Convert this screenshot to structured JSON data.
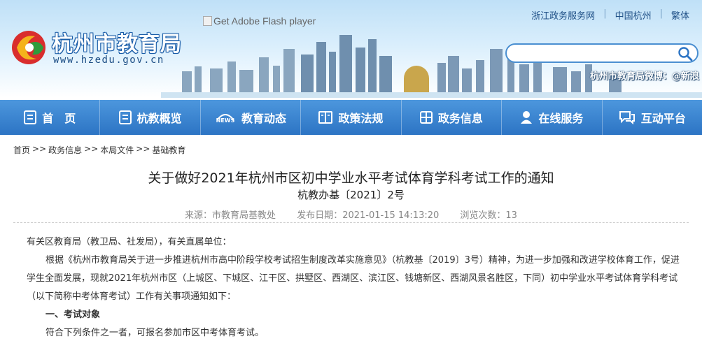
{
  "header": {
    "site_name": "杭州市教育局",
    "site_url": "www.hzedu.gov.cn",
    "flash_placeholder": "Get Adobe Flash player",
    "top_links": [
      "浙江政务服务网",
      "中国杭州",
      "繁体"
    ],
    "search_placeholder": "",
    "weibo_text": "杭州市教育局微博：@新浪"
  },
  "nav": {
    "items": [
      {
        "label": "首　页",
        "icon": "doc-icon"
      },
      {
        "label": "杭教概览",
        "icon": "doc-icon"
      },
      {
        "label": "教育动态",
        "icon": "news-icon"
      },
      {
        "label": "政策法规",
        "icon": "book-icon"
      },
      {
        "label": "政务信息",
        "icon": "grid-icon"
      },
      {
        "label": "在线服务",
        "icon": "person-icon"
      },
      {
        "label": "互动平台",
        "icon": "chat-icon"
      }
    ]
  },
  "breadcrumb": {
    "items": [
      "首页",
      "政务信息",
      "本局文件",
      "基础教育"
    ],
    "separator": ">>"
  },
  "article": {
    "title": "关于做好2021年杭州市区初中学业水平考试体育学科考试工作的通知",
    "doc_number": "杭教办基〔2021〕2号",
    "source": "来源：市教育局基教处",
    "publish_date": "发布日期：2021-01-15 14:13:20",
    "views": "浏览次数：13",
    "paragraphs": [
      "有关区教育局（教卫局、社发局），有关直属单位：",
      "根据《杭州市教育局关于进一步推进杭州市高中阶段学校考试招生制度改革实施意见》（杭教基〔2019〕3号）精神，为进一步加强和改进学校体育工作，促进学生全面发展，现就2021年杭州市区（上城区、下城区、江干区、拱墅区、西湖区、滨江区、钱塘新区、西湖风景名胜区，下同）初中学业水平考试体育学科考试（以下简称中考体育考试）工作有关事项通知如下：",
      "一、考试对象",
      "符合下列条件之一者，可报名参加市区中考体育考试。"
    ]
  },
  "colors": {
    "nav_top": "#4d97dd",
    "nav_bottom": "#2c74c4",
    "link_blue": "#1e4f86"
  }
}
